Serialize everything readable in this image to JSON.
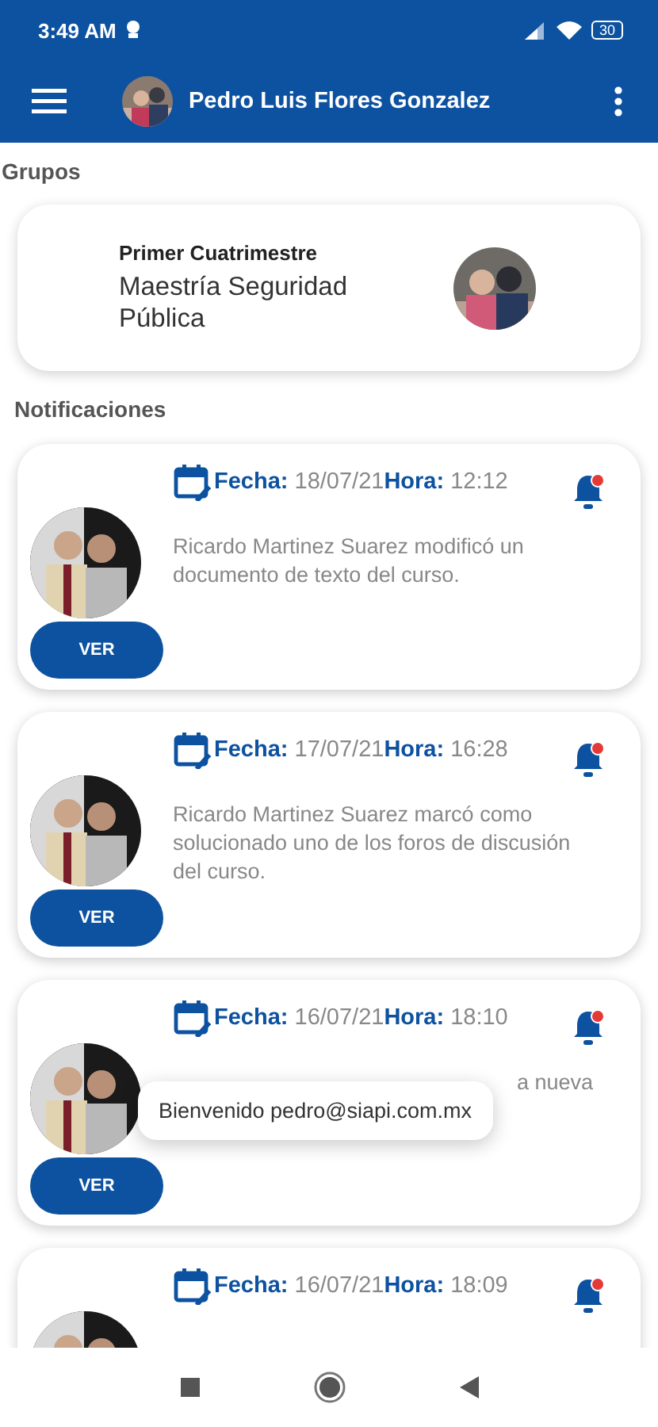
{
  "status_bar": {
    "time": "3:49 AM",
    "battery": "30"
  },
  "app_bar": {
    "user_name": "Pedro Luis Flores Gonzalez"
  },
  "groups": {
    "heading": "Grupos",
    "items": [
      {
        "period": "Primer Cuatrimestre",
        "name": "Maestría Seguridad Pública"
      }
    ]
  },
  "notifications": {
    "heading": "Notificaciones",
    "items": [
      {
        "date_label": "Fecha:",
        "date": "18/07/21",
        "time_label": "Hora:",
        "time": "12:12",
        "unread": true,
        "message": "Ricardo Martinez Suarez modificó un documento de texto del curso.",
        "button": "VER"
      },
      {
        "date_label": "Fecha:",
        "date": "17/07/21",
        "time_label": "Hora:",
        "time": "16:28",
        "unread": true,
        "message": "Ricardo Martinez Suarez marcó como solucionado uno de los foros de discusión del curso.",
        "button": "VER"
      },
      {
        "date_label": "Fecha:",
        "date": "16/07/21",
        "time_label": "Hora:",
        "time": "18:10",
        "unread": true,
        "message_tail": "a nueva",
        "button": "VER"
      },
      {
        "date_label": "Fecha:",
        "date": "16/07/21",
        "time_label": "Hora:",
        "time": "18:09",
        "unread": true
      }
    ]
  },
  "toast": {
    "text": "Bienvenido pedro@siapi.com.mx"
  }
}
